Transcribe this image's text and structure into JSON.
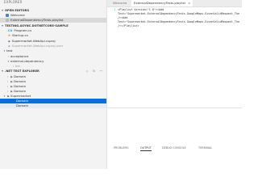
{
  "explorer": {
    "title": "EXPLORER",
    "open_editors_label": "OPEN EDITORS",
    "open_editors": [
      {
        "label": "Welcome"
      },
      {
        "label": "ExternalDependencyTests.playlist"
      }
    ],
    "workspace_label": "TESTING.ASYNC.DOTNETCORE-SAMPLE",
    "workspace_items": [
      {
        "label": "Program.cs",
        "icon": "csharp-icon"
      },
      {
        "label": "Startup.cs",
        "icon": "gear-icon"
      },
      {
        "label": "Supermarket.WebApi.csproj",
        "icon": "project-icon"
      },
      {
        "label": "Supermarket.WebApi.csproj.user",
        "icon": "project-icon"
      }
    ],
    "folder_test": "test",
    "test_children": [
      {
        "label": "acceptance"
      },
      {
        "label": "external-dependency"
      },
      {
        "label": "bin"
      }
    ]
  },
  "test_explorer": {
    "label": ".NET TEST EXPLORER",
    "items": [
      {
        "label": "Domain"
      },
      {
        "label": "Domain"
      },
      {
        "label": "Domain"
      },
      {
        "label": "Domain"
      },
      {
        "label": "Supermarket"
      },
      {
        "label": "Domain"
      },
      {
        "label": "Domain"
      }
    ]
  },
  "tabs": [
    {
      "label": "Welcome"
    },
    {
      "label": "ExternalDependencyTests.playlist"
    }
  ],
  "editor": {
    "lines": [
      {
        "num": "1",
        "text": "<Playlist Version=\"1.0\"><Add"
      },
      {
        "num": "",
        "text": "Test=\"Supermarket.ExternalDependencyTests.GoogleMaps.GivenValidRequest_The"
      },
      {
        "num": "",
        "text": "/><Add"
      },
      {
        "num": "",
        "text": "Test=\"Supermarket.ExternalDependencyTests.GoogleMaps.GivenValidRequest_The"
      },
      {
        "num": "",
        "text": "/></Playlist>"
      }
    ]
  },
  "panel": {
    "tabs": [
      "PROBLEMS",
      "OUTPUT",
      "DEBUG CONSOLE",
      "TERMINAL"
    ],
    "active_tab": "OUTPUT"
  },
  "colors": {
    "accent": "#0a6fd6",
    "sidebar_bg": "#f3f3f3"
  }
}
